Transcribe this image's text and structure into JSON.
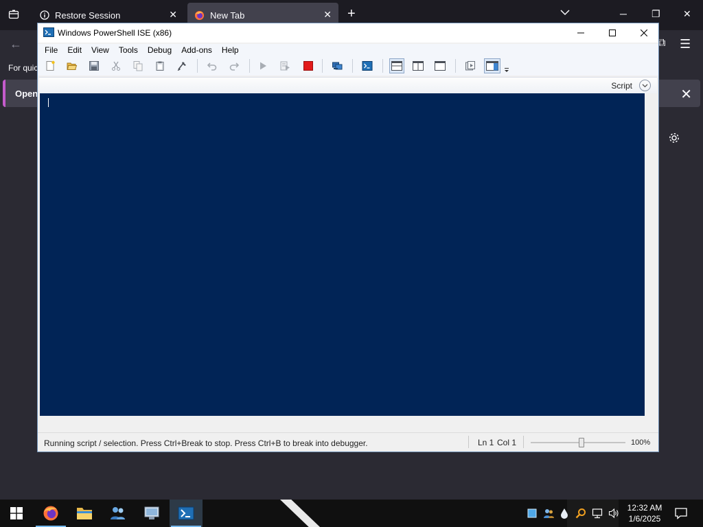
{
  "firefox": {
    "tabs": [
      {
        "label": "Restore Session",
        "icon": "info-icon",
        "active": false
      },
      {
        "label": "New Tab",
        "icon": "firefox-icon",
        "active": true
      }
    ],
    "quick_search_text": "For quic",
    "notice_text": "Open I"
  },
  "ise": {
    "title": "Windows PowerShell ISE (x86)",
    "menu": [
      "File",
      "Edit",
      "View",
      "Tools",
      "Debug",
      "Add-ons",
      "Help"
    ],
    "toolbar": [
      "new-script-icon",
      "open-icon",
      "save-icon",
      "cut-icon",
      "copy-icon",
      "paste-icon",
      "clear-console-icon",
      "undo-icon",
      "redo-icon",
      "run-script-icon",
      "run-selection-icon",
      "stop-operation-icon",
      "remote-powershell-icon",
      "start-powershell-exe-icon",
      "script-pane-top-icon",
      "script-pane-right-icon",
      "script-pane-maximized-icon",
      "show-script-pane-icon",
      "show-command-window-icon",
      "toolbar-overflow-icon"
    ],
    "script_toggle_label": "Script",
    "status": {
      "message": "Running script / selection.  Press Ctrl+Break to stop.  Press Ctrl+B to break into debugger.",
      "line": "Ln 1",
      "column": "Col 1",
      "zoom": "100%",
      "zoom_level": 1.0
    },
    "colors": {
      "console_background": "#012456",
      "title_bar": "#ffffff",
      "stop_button": "#e21b1b"
    }
  },
  "taskbar": {
    "apps": [
      "firefox-icon",
      "file-explorer-icon",
      "people-icon",
      "control-panel-icon",
      "powershell-ise-icon"
    ],
    "tray": [
      "show-desktop-icon",
      "network-users-icon",
      "water-drop-icon",
      "search-tray-icon",
      "network-icon",
      "volume-icon"
    ],
    "time": "12:32 AM",
    "date": "1/6/2025"
  }
}
